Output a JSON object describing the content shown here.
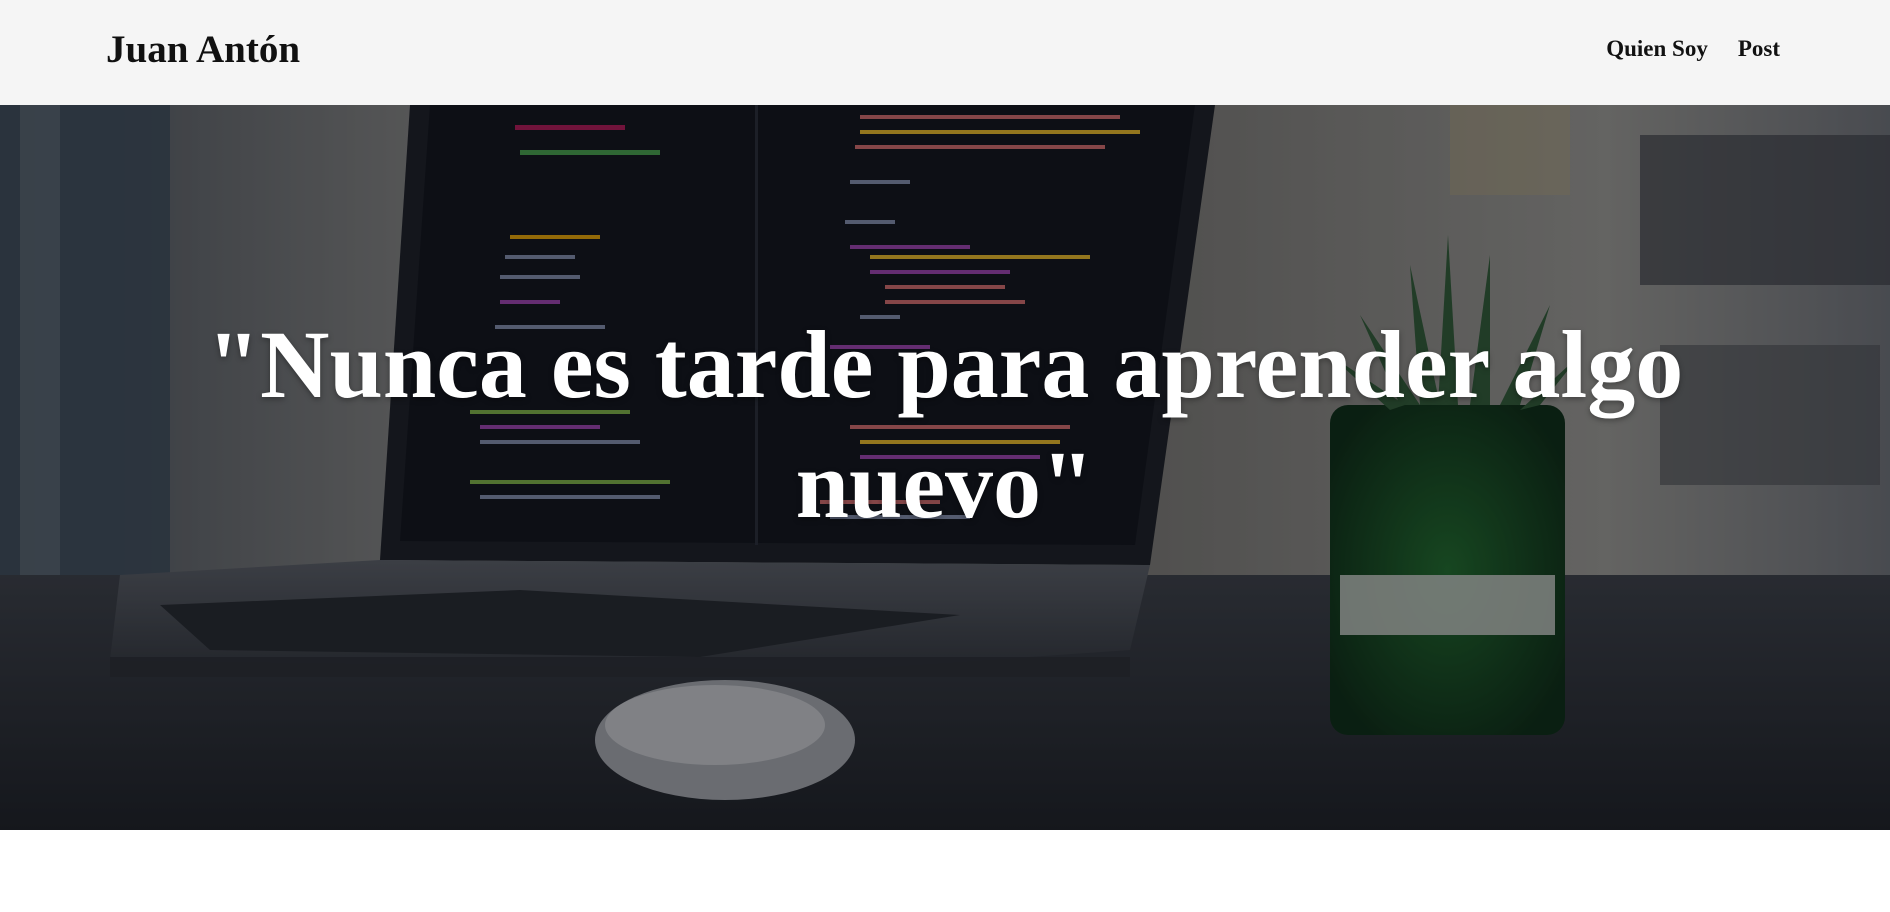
{
  "header": {
    "brand": "Juan Antón",
    "nav": [
      {
        "label": "Quien Soy"
      },
      {
        "label": "Post"
      }
    ]
  },
  "hero": {
    "quote": "\"Nunca es tarde para aprender algo nuevo\"",
    "background_description_icon": "laptop-code-photo"
  },
  "colors": {
    "header_bg": "#f5f5f5",
    "text_dark": "#111111",
    "hero_text": "#ffffff"
  }
}
